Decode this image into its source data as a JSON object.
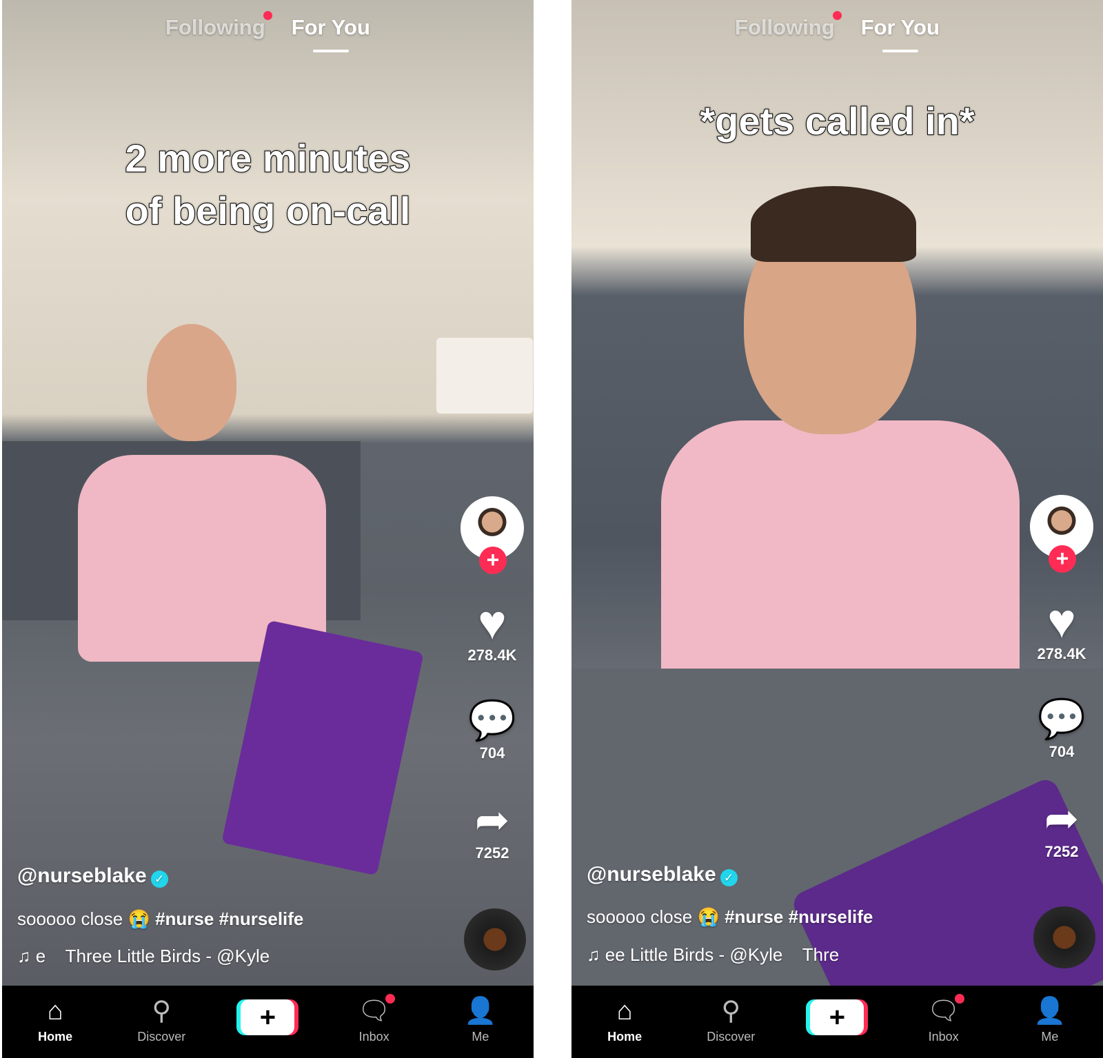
{
  "panels": [
    {
      "tabs": {
        "following": "Following",
        "for_you": "For You"
      },
      "caption_lines": [
        "2 more minutes",
        "of being on-call"
      ],
      "likes": "278.4K",
      "comments": "704",
      "shares": "7252",
      "username": "@nurseblake",
      "description": "sooooo close",
      "emoji": "😭",
      "hashtags": "#nurse #nurselife",
      "music": "e    Three Little Birds - @Kyle"
    },
    {
      "tabs": {
        "following": "Following",
        "for_you": "For You"
      },
      "caption_lines": [
        "*gets called in*"
      ],
      "likes": "278.4K",
      "comments": "704",
      "shares": "7252",
      "username": "@nurseblake",
      "description": "sooooo close",
      "emoji": "😭",
      "hashtags": "#nurse #nurselife",
      "music": "ee Little Birds - @Kyle    Thre"
    }
  ],
  "nav": {
    "home": "Home",
    "discover": "Discover",
    "inbox": "Inbox",
    "me": "Me"
  },
  "colors": {
    "accent_red": "#fe2c55",
    "accent_cyan": "#25f4ee",
    "verified": "#20d5ec"
  }
}
